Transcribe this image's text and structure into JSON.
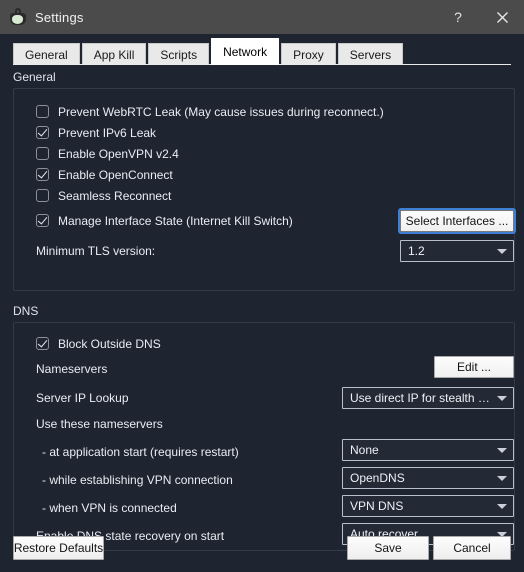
{
  "titlebar": {
    "title": "Settings",
    "icon": "app-cloud-icon",
    "help_label": "?",
    "close_label": "✕"
  },
  "tabs": [
    {
      "label": "General",
      "active": false
    },
    {
      "label": "App Kill",
      "active": false
    },
    {
      "label": "Scripts",
      "active": false
    },
    {
      "label": "Network",
      "active": true
    },
    {
      "label": "Proxy",
      "active": false
    },
    {
      "label": "Servers",
      "active": false
    }
  ],
  "general": {
    "group_title": "General",
    "checkboxes": [
      {
        "label": "Prevent WebRTC Leak (May cause issues during reconnect.)",
        "checked": false
      },
      {
        "label": "Prevent IPv6 Leak",
        "checked": true
      },
      {
        "label": "Enable OpenVPN v2.4",
        "checked": false
      },
      {
        "label": "Enable OpenConnect",
        "checked": true
      },
      {
        "label": "Seamless Reconnect",
        "checked": false
      },
      {
        "label": "Manage Interface State (Internet Kill Switch)",
        "checked": true
      }
    ],
    "select_interfaces_button": "Select Interfaces ...",
    "tls_label": "Minimum TLS version:",
    "tls_value": "1.2"
  },
  "dns": {
    "group_title": "DNS",
    "block_outside_dns_label": "Block Outside DNS",
    "block_outside_dns_checked": true,
    "nameservers_label": "Nameservers",
    "nameservers_edit_button": "Edit ...",
    "server_ip_lookup_label": "Server IP Lookup",
    "server_ip_lookup_value": "Use direct IP for stealth only",
    "use_these_nameservers_label": "Use these nameservers",
    "rows": [
      {
        "label": "- at application start (requires restart)",
        "value": "None"
      },
      {
        "label": "- while establishing VPN connection",
        "value": "OpenDNS"
      },
      {
        "label": "- when VPN is connected",
        "value": "VPN DNS"
      },
      {
        "label": "Enable DNS state recovery on start",
        "value": "Auto recover"
      }
    ]
  },
  "footer": {
    "restore_defaults": "Restore Defaults",
    "save": "Save",
    "cancel": "Cancel"
  },
  "colors": {
    "titlebar": "#4b4b4b",
    "body": "#1e2430",
    "tab_active": "#ffffff",
    "tab_inactive": "#e9e9e9",
    "focus_ring": "#3f7fd4"
  }
}
